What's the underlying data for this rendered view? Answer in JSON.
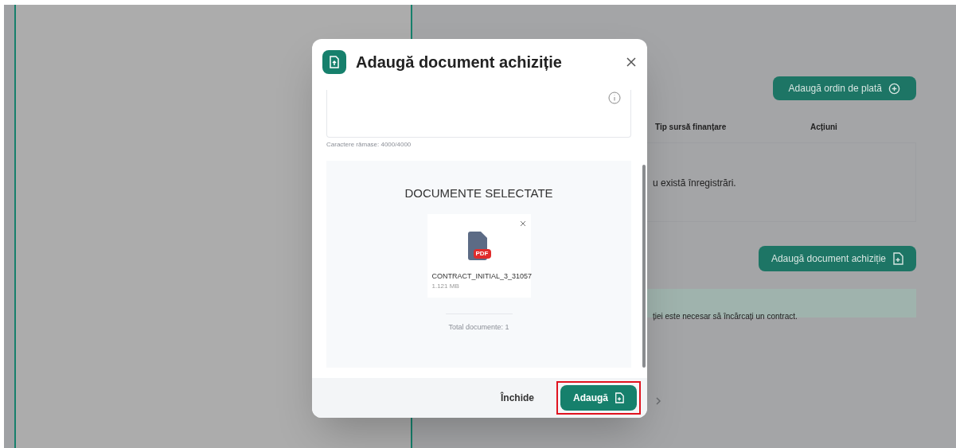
{
  "background": {
    "payment_button": "Adaugă ordin de plată",
    "table": {
      "columns": [
        "Tip sursă finanțare",
        "Acțiuni"
      ],
      "empty_message": "u există înregistrări."
    },
    "document_button": "Adaugă document achiziție",
    "alert": "ției este necesar să încărcați un contract."
  },
  "modal": {
    "title": "Adaugă document achiziție",
    "counter": "Caractere rămase: 4000/4000",
    "documents": {
      "heading": "DOCUMENTE SELECTATE",
      "files": [
        {
          "type": "PDF",
          "name": "CONTRACT_INITIAL_3_31057",
          "size": "1.121 MB"
        }
      ],
      "total": "Total documente: 1"
    },
    "buttons": [
      {
        "kind": "secondary",
        "label": "Închide"
      },
      {
        "kind": "primary",
        "label": "Adaugă",
        "highlighted": true
      }
    ]
  }
}
